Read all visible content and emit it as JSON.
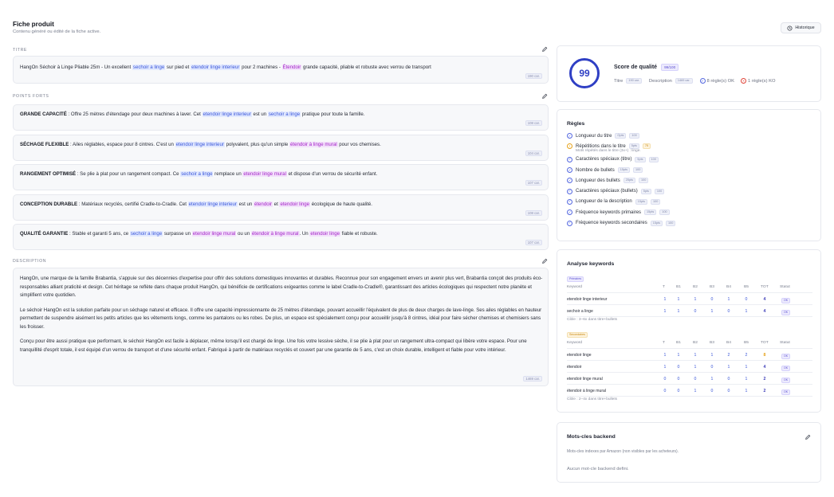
{
  "header": {
    "title": "Fiche produit",
    "subtitle": "Contenu généré ou édité de la fiche active.",
    "history_label": "Historique"
  },
  "titre": {
    "label": "TITRE",
    "parts": [
      {
        "t": "HangOn Séchoir à Linge Pliable 25m - Un excellent "
      },
      {
        "t": "sechoir a linge",
        "hl": "blue"
      },
      {
        "t": " sur pied et "
      },
      {
        "t": "etendoir linge interieur",
        "hl": "blue"
      },
      {
        "t": " pour 2 machines - "
      },
      {
        "t": "Étendoir",
        "hl": "purple"
      },
      {
        "t": " grande capacité, pliable et robuste avec verrou de transport"
      }
    ],
    "chip": "190 car."
  },
  "points_forts": {
    "label": "POINTS FORTS",
    "items": [
      {
        "parts": [
          {
            "t": "GRANDE CAPACITÉ",
            "bold": true
          },
          {
            "t": " : Offre 25 mètres d'étendage pour deux machines à laver. Cet "
          },
          {
            "t": "etendoir linge interieur",
            "hl": "blue"
          },
          {
            "t": " est un "
          },
          {
            "t": "sechoir a linge",
            "hl": "blue"
          },
          {
            "t": " pratique pour toute la famille."
          }
        ],
        "chip": "108 car."
      },
      {
        "parts": [
          {
            "t": "SÉCHAGE FLEXIBLE",
            "bold": true
          },
          {
            "t": " : Ailes réglables, espace pour 8 cintres. C'est un "
          },
          {
            "t": "etendoir linge interieur",
            "hl": "blue"
          },
          {
            "t": " polyvalent, plus qu'un simple "
          },
          {
            "t": "étendoir à linge mural",
            "hl": "purple"
          },
          {
            "t": " pour vos chemises."
          }
        ],
        "chip": "104 car."
      },
      {
        "parts": [
          {
            "t": "RANGEMENT OPTIMISÉ",
            "bold": true
          },
          {
            "t": " : Se plie à plat pour un rangement compact. Ce "
          },
          {
            "t": "sechoir a linge",
            "hl": "blue"
          },
          {
            "t": " remplace un "
          },
          {
            "t": "etendoir linge mural",
            "hl": "purple"
          },
          {
            "t": " et dispose d'un verrou de sécurité enfant."
          }
        ],
        "chip": "107 car."
      },
      {
        "parts": [
          {
            "t": "CONCEPTION DURABLE",
            "bold": true
          },
          {
            "t": " : Matériaux recyclés, certifié Cradle-to-Cradle. Cet "
          },
          {
            "t": "etendoir linge interieur",
            "hl": "blue"
          },
          {
            "t": " est un "
          },
          {
            "t": "étendoir",
            "hl": "purple"
          },
          {
            "t": " et "
          },
          {
            "t": "etendoir linge",
            "hl": "purple"
          },
          {
            "t": " écologique de haute qualité."
          }
        ],
        "chip": "108 car."
      },
      {
        "parts": [
          {
            "t": "QUALITÉ GARANTIE",
            "bold": true
          },
          {
            "t": " : Stable et garanti 5 ans, ce "
          },
          {
            "t": "sechoir a linge",
            "hl": "blue"
          },
          {
            "t": " surpasse un "
          },
          {
            "t": "etendoir linge mural",
            "hl": "purple"
          },
          {
            "t": " ou un "
          },
          {
            "t": "étendoir à linge mural",
            "hl": "purple"
          },
          {
            "t": ". Un "
          },
          {
            "t": "etendoir linge",
            "hl": "purple"
          },
          {
            "t": " fiable et robuste."
          }
        ],
        "chip": "107 car."
      }
    ]
  },
  "description": {
    "label": "DESCRIPTION",
    "paragraphs": [
      "HangOn, une marque de la famille Brabantia, s'appuie sur des décennies d'expertise pour offrir des solutions domestiques innovantes et durables. Reconnue pour son engagement envers un avenir plus vert, Brabantia conçoit des produits éco-responsables alliant praticité et design. Cet héritage se reflète dans chaque produit HangOn, qui bénéficie de certifications exigeantes comme le label Cradle-to-Cradle®, garantissant des articles écologiques qui respectent notre planète et simplifient votre quotidien.",
      "Le séchoir HangOn est la solution parfaite pour un séchage naturel et efficace. Il offre une capacité impressionnante de 25 mètres d'étendage, pouvant accueillir l'équivalent de plus de deux charges de lave-linge. Ses ailes réglables en hauteur permettent de suspendre aisément les petits articles que les vêtements longs, comme les pantalons ou les robes. De plus, un espace est spécialement conçu pour accueillir jusqu'à 8 cintres, idéal pour faire sécher chemises et chemisiers sans les froisser.",
      "Conçu pour être aussi pratique que performant, le séchoir HangOn est facile à déplacer, même lorsqu'il est chargé de linge. Une fois votre lessive sèche, il se plie à plat pour un rangement ultra-compact qui libère votre espace. Pour une tranquillité d'esprit totale, il est équipé d'un verrou de transport et d'une sécurité enfant. Fabriqué à partir de matériaux recyclés et couvert par une garantie de 5 ans, c'est un choix durable, intelligent et fiable pour votre intérieur."
    ],
    "chip": "1469 car."
  },
  "score": {
    "value": "99",
    "label": "Score de qualité",
    "badge": "99/100",
    "titre_label": "Titre",
    "titre_chip": "190 car.",
    "desc_label": "Description",
    "desc_chip": "1469 car.",
    "ok_text": "8 règle(s) OK",
    "ko_text": "1 règle(s) KO"
  },
  "regles": {
    "title": "Règles",
    "items": [
      {
        "label": "Longueur du titre",
        "chip1": "Opts",
        "chip2": "100",
        "warn": false
      },
      {
        "label": "Répétitions dans le titre",
        "chip1": "5pts",
        "chip2": "75",
        "warn": true,
        "sub": "Mots répétés dans le titre (3x+) : linge."
      },
      {
        "label": "Caractères spéciaux (titre)",
        "chip1": "5pts",
        "chip2": "100",
        "warn": false
      },
      {
        "label": "Nombre de bullets",
        "chip1": "15pts",
        "chip2": "100",
        "warn": false
      },
      {
        "label": "Longueur des bullets",
        "chip1": "25pts",
        "chip2": "100",
        "warn": false
      },
      {
        "label": "Caractères spéciaux (bullets)",
        "chip1": "5pts",
        "chip2": "100",
        "warn": false
      },
      {
        "label": "Longueur de la description",
        "chip1": "15pts",
        "chip2": "100",
        "warn": false
      },
      {
        "label": "Fréquence keywords primaires",
        "chip1": "15pts",
        "chip2": "100",
        "warn": false
      },
      {
        "label": "Fréquence keywords secondaires",
        "chip1": "15pts",
        "chip2": "100",
        "warn": false
      }
    ]
  },
  "keywords": {
    "title": "Analyse keywords",
    "columns": [
      "Keyword",
      "T",
      "B1",
      "B2",
      "B3",
      "B4",
      "B5",
      "TOT",
      "Statut"
    ],
    "primary": {
      "tag": "Primaires",
      "rows": [
        {
          "kw": "etendoir linge interieur",
          "vals": [
            "1",
            "1",
            "1",
            "0",
            "1",
            "0"
          ],
          "tot": "4",
          "status": "OK"
        },
        {
          "kw": "sechoir a linge",
          "vals": [
            "1",
            "1",
            "0",
            "1",
            "0",
            "1"
          ],
          "tot": "4",
          "status": "OK"
        }
      ],
      "cible": "Cible : 3–6x dans titre+bullets"
    },
    "secondary": {
      "tag": "Secondaires",
      "rows": [
        {
          "kw": "etendoir linge",
          "vals": [
            "1",
            "1",
            "1",
            "1",
            "2",
            "2"
          ],
          "tot": "8",
          "status": "OK",
          "tot_orange": true
        },
        {
          "kw": "étendoir",
          "vals": [
            "1",
            "0",
            "1",
            "0",
            "1",
            "1"
          ],
          "tot": "4",
          "status": "OK"
        },
        {
          "kw": "etendoir linge mural",
          "vals": [
            "0",
            "0",
            "0",
            "1",
            "0",
            "1"
          ],
          "tot": "2",
          "status": "OK"
        },
        {
          "kw": "étendoir à linge mural",
          "vals": [
            "0",
            "0",
            "1",
            "0",
            "0",
            "1"
          ],
          "tot": "2",
          "status": "OK"
        }
      ],
      "cible": "Cible : 2–4x dans titre+bullets"
    }
  },
  "backend": {
    "title": "Mots-cles backend",
    "subtitle": "Mots-cles indexes par Amazon (non visibles par les acheteurs).",
    "empty": "Aucun mot-cle backend defini."
  },
  "colors": {
    "accent": "#2f3fc4",
    "highlight_primary": "#3b57d9",
    "highlight_secondary": "#a326c7",
    "warn": "#e6a21a",
    "ko": "#e0453a"
  }
}
